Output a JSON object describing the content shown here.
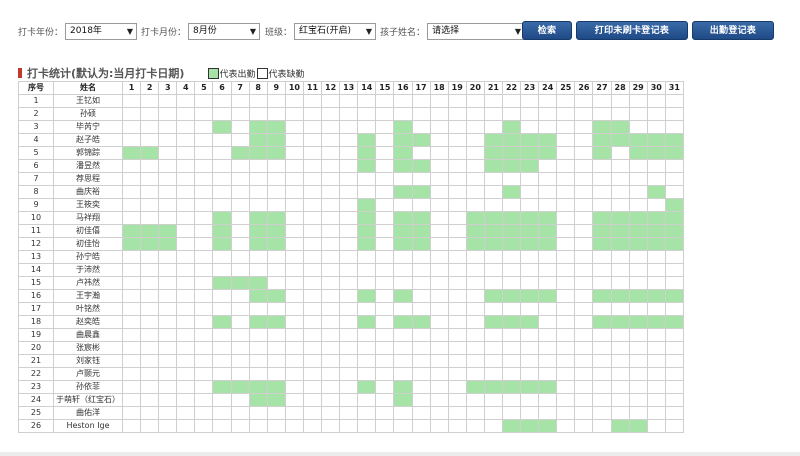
{
  "filters": {
    "year_label": "打卡年份：",
    "year_value": "2018年",
    "month_label": "打卡月份：",
    "month_value": "8月份",
    "class_label": "班级：",
    "class_value": "红宝石(开启)",
    "child_label": "孩子姓名：",
    "child_value": "请选择"
  },
  "buttons": {
    "search": "检索",
    "print_unpunched": "打印未刷卡登记表",
    "attendance": "出勤登记表"
  },
  "section": {
    "title": "打卡统计(默认为:当月打卡日期)",
    "legend_present": "代表出勤",
    "legend_absent": "代表缺勤"
  },
  "colors": {
    "present": "#a6e3a6",
    "absent": "#ffffff",
    "button": "#2a5a96",
    "section_accent": "#c0392b"
  },
  "table": {
    "col_index": "序号",
    "col_name": "姓名",
    "days": [
      "1",
      "2",
      "3",
      "4",
      "5",
      "6",
      "7",
      "8",
      "9",
      "10",
      "11",
      "12",
      "13",
      "14",
      "15",
      "16",
      "17",
      "18",
      "19",
      "20",
      "21",
      "22",
      "23",
      "24",
      "25",
      "26",
      "27",
      "28",
      "29",
      "30",
      "31"
    ],
    "rows": [
      {
        "no": "1",
        "name": "王钇如",
        "present": []
      },
      {
        "no": "2",
        "name": "孙硕",
        "present": []
      },
      {
        "no": "3",
        "name": "毕芮宁",
        "present": [
          6,
          8,
          9,
          16,
          22,
          27,
          28
        ]
      },
      {
        "no": "4",
        "name": "赵子皓",
        "present": [
          8,
          9,
          14,
          16,
          17,
          21,
          22,
          23,
          24,
          27,
          28,
          29,
          30,
          31
        ]
      },
      {
        "no": "5",
        "name": "郭锦踪",
        "present": [
          1,
          2,
          7,
          8,
          9,
          14,
          16,
          21,
          22,
          23,
          24,
          27,
          29,
          30,
          31
        ]
      },
      {
        "no": "6",
        "name": "潘昱然",
        "present": [
          14,
          16,
          17,
          21,
          22,
          23
        ]
      },
      {
        "no": "7",
        "name": "荐思程",
        "present": []
      },
      {
        "no": "8",
        "name": "曲庆裕",
        "present": [
          16,
          17,
          22,
          30
        ]
      },
      {
        "no": "9",
        "name": "王筱奕",
        "present": [
          14,
          31
        ]
      },
      {
        "no": "10",
        "name": "马祥翔",
        "present": [
          6,
          8,
          9,
          14,
          16,
          17,
          20,
          21,
          22,
          23,
          24,
          27,
          28,
          29,
          30,
          31
        ]
      },
      {
        "no": "11",
        "name": "初佳僖",
        "present": [
          1,
          2,
          3,
          6,
          8,
          9,
          14,
          16,
          17,
          20,
          21,
          22,
          23,
          24,
          27,
          28,
          29,
          30,
          31
        ]
      },
      {
        "no": "12",
        "name": "初佳怡",
        "present": [
          1,
          2,
          3,
          6,
          8,
          9,
          14,
          16,
          17,
          20,
          21,
          22,
          23,
          24,
          27,
          28,
          29,
          30,
          31
        ]
      },
      {
        "no": "13",
        "name": "孙宁皓",
        "present": []
      },
      {
        "no": "14",
        "name": "于沛然",
        "present": []
      },
      {
        "no": "15",
        "name": "卢祎然",
        "present": [
          6,
          7,
          8
        ]
      },
      {
        "no": "16",
        "name": "王宇瀚",
        "present": [
          8,
          9,
          14,
          16,
          21,
          22,
          23,
          24,
          27,
          28,
          29,
          30,
          31
        ]
      },
      {
        "no": "17",
        "name": "叶铭然",
        "present": []
      },
      {
        "no": "18",
        "name": "赵奕皓",
        "present": [
          6,
          8,
          9,
          14,
          16,
          17,
          21,
          22,
          23,
          27,
          28,
          29,
          30,
          31
        ]
      },
      {
        "no": "19",
        "name": "曲晨鑫",
        "present": []
      },
      {
        "no": "20",
        "name": "张宸彬",
        "present": []
      },
      {
        "no": "21",
        "name": "刘家钰",
        "present": []
      },
      {
        "no": "22",
        "name": "卢颢元",
        "present": []
      },
      {
        "no": "23",
        "name": "孙依菲",
        "present": [
          6,
          7,
          8,
          9,
          14,
          16,
          20,
          21,
          22,
          23,
          24
        ]
      },
      {
        "no": "24",
        "name": "于萌轩（红宝石）",
        "present": [
          8,
          9,
          16
        ]
      },
      {
        "no": "25",
        "name": "曲佑洋",
        "present": []
      },
      {
        "no": "26",
        "name": "Heston Ige",
        "present": [
          22,
          23,
          24,
          28,
          29
        ]
      }
    ]
  }
}
